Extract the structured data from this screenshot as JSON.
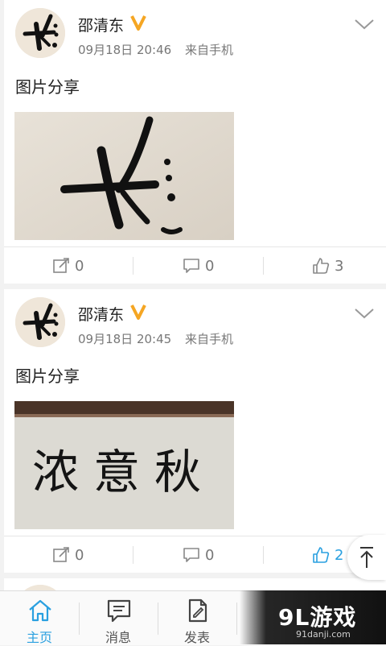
{
  "posts": [
    {
      "user": "邵清东",
      "date": "09月18日 20:46",
      "source": "来自手机",
      "text": "图片分享",
      "photo": "calligraphy-single",
      "comments": "0",
      "reposts": "0",
      "likes": "3",
      "liked": false
    },
    {
      "user": "邵清东",
      "date": "09月18日 20:45",
      "source": "来自手机",
      "text": "图片分享",
      "photo": "calligraphy-nongyiqiu",
      "comments": "0",
      "reposts": "0",
      "likes": "2",
      "liked": true
    }
  ],
  "calligraphy_text": "浓意秋",
  "tabs": [
    {
      "label": "主页",
      "icon": "home-icon",
      "active": true
    },
    {
      "label": "消息",
      "icon": "message-icon",
      "active": false
    },
    {
      "label": "发表",
      "icon": "compose-icon",
      "active": false
    }
  ],
  "watermark": {
    "logo": "9L游戏",
    "url": "91danji.com"
  },
  "colors": {
    "accent": "#2aa0e0",
    "vbadge": "#f5a623"
  }
}
